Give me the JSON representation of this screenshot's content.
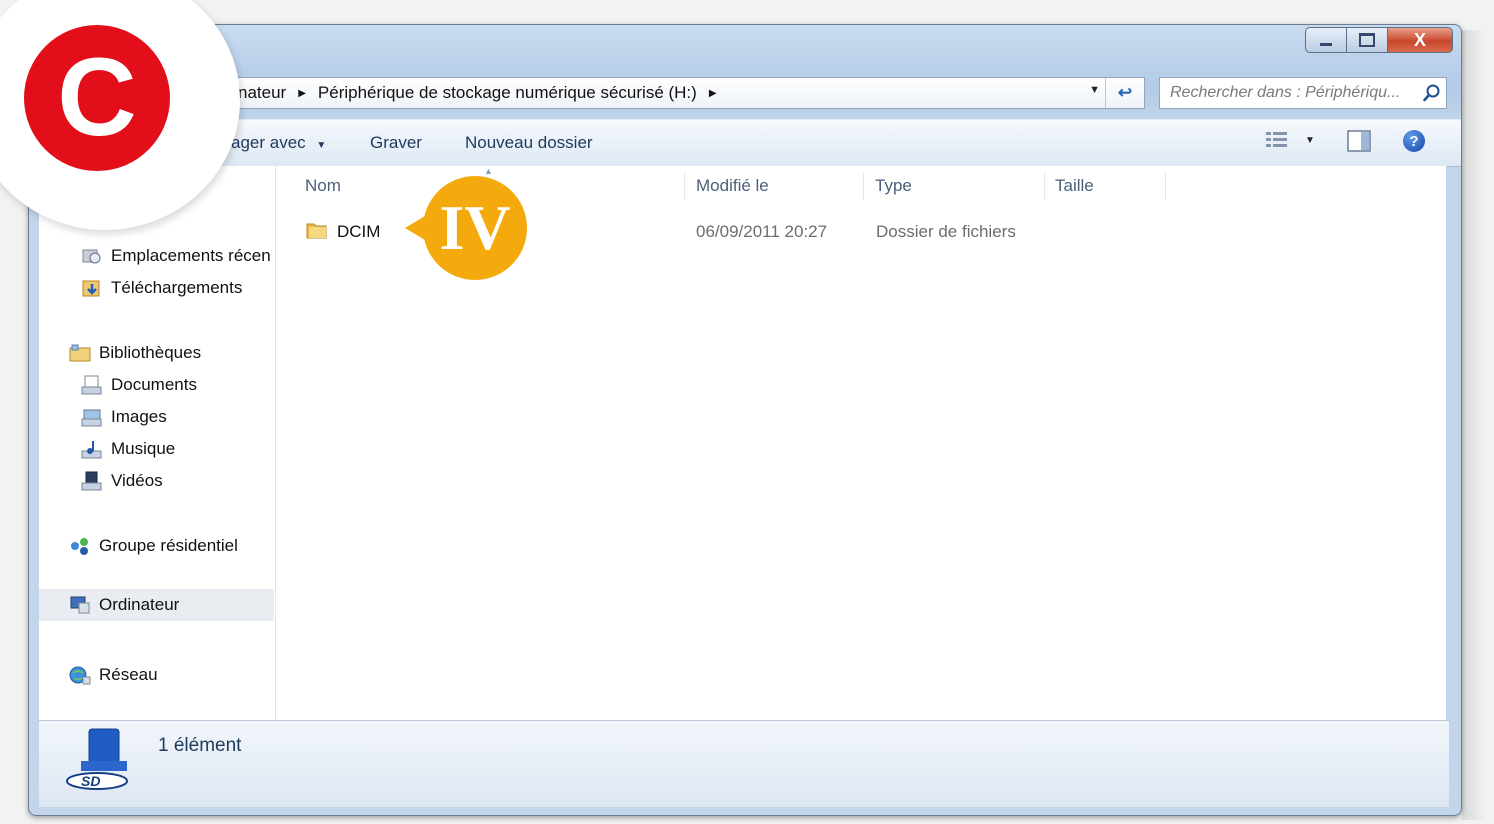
{
  "window": {
    "controls": {
      "minimize": "",
      "maximize": "",
      "close": "X"
    }
  },
  "address_bar": {
    "crumbs": [
      "nateur",
      "Périphérique de stockage numérique sécurisé (H:)"
    ]
  },
  "search": {
    "placeholder": "Rechercher dans : Périphériqu..."
  },
  "toolbar": {
    "share": "ager avec",
    "burn": "Graver",
    "new_folder": "Nouveau dossier",
    "help": "?"
  },
  "nav": {
    "partial": "...",
    "recent": "Emplacements récen",
    "downloads": "Téléchargements",
    "libraries": "Bibliothèques",
    "documents": "Documents",
    "images": "Images",
    "music": "Musique",
    "videos": "Vidéos",
    "homegroup": "Groupe résidentiel",
    "computer": "Ordinateur",
    "network": "Réseau"
  },
  "columns": {
    "name": "Nom",
    "modified": "Modifié le",
    "type": "Type",
    "size": "Taille"
  },
  "files": [
    {
      "name": "DCIM",
      "modified": "06/09/2011 20:27",
      "type": "Dossier de fichiers",
      "size": ""
    }
  ],
  "status": {
    "count": "1 élément"
  },
  "badges": {
    "step": "C",
    "marker": "IV",
    "step_color": "#e20f1a",
    "marker_color": "#f4a90d"
  }
}
